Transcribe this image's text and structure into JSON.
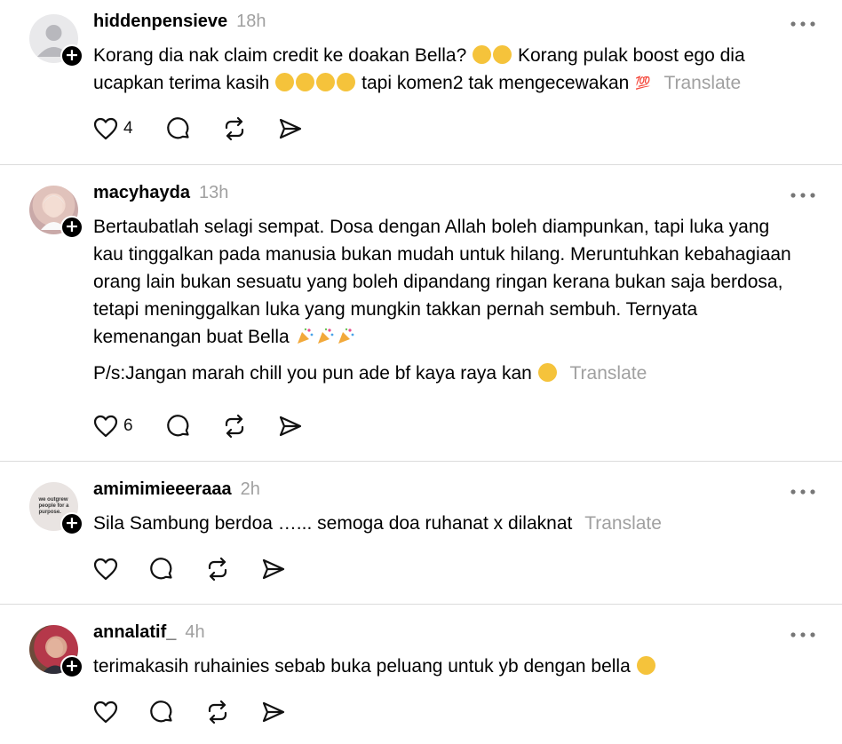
{
  "posts": [
    {
      "username": "hiddenpensieve",
      "time": "18h",
      "line1_a": "Korang dia nak claim credit ke doakan Bella?",
      "line1_b": "Korang pulak boost ego dia",
      "line2_a": "ucapkan terima kasih",
      "line2_b": "tapi komen2 tak mengecewakan",
      "emoji_100": "💯",
      "translate": "Translate",
      "likes": "4"
    },
    {
      "username": "macyhayda",
      "time": "13h",
      "paragraph": "Bertaubatlah selagi sempat. Dosa dengan Allah boleh diampunkan, tapi luka yang kau tinggalkan pada manusia bukan mudah untuk hilang. Meruntuhkan kebahagiaan orang lain bukan sesuatu yang boleh dipandang ringan kerana bukan saja berdosa, tetapi meninggalkan luka yang mungkin takkan pernah sembuh. Ternyata kemenangan buat Bella",
      "ps": "P/s:Jangan marah chill you pun ade bf kaya raya kan",
      "translate": "Translate",
      "likes": "6"
    },
    {
      "username": "amimimieeeraaa",
      "time": "2h",
      "text": "Sila Sambung berdoa …... semoga doa ruhanat x dilaknat",
      "translate": "Translate",
      "avatar_text": "we outgrew people for a purpose."
    },
    {
      "username": "annalatif_",
      "time": "4h",
      "text": "terimakasih ruhainies sebab buka peluang untuk yb dengan bella"
    }
  ],
  "icons": {
    "like": "heart-icon",
    "comment": "comment-icon",
    "repost": "repost-icon",
    "share": "send-icon",
    "more": "more-icon",
    "follow": "plus-icon"
  }
}
